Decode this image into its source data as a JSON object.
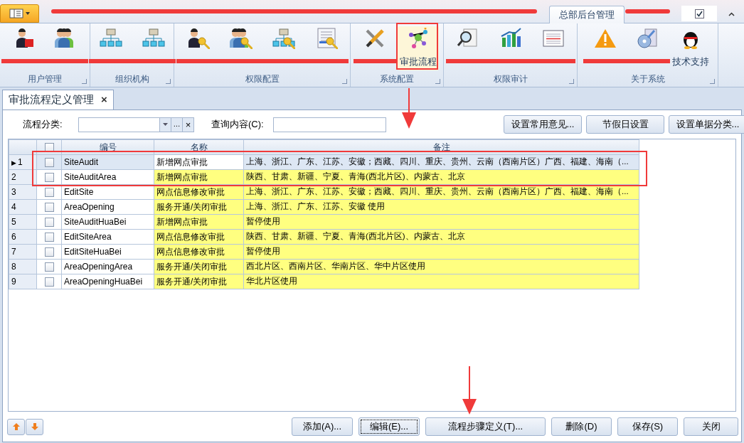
{
  "ribbon_tabs": [
    {
      "kind": "struck"
    },
    {
      "label": "总部后台管理",
      "selected": true
    },
    {
      "kind": "struck"
    }
  ],
  "ribbon_groups": [
    {
      "title": "用户管理",
      "buttons": [
        {
          "kind": "struck"
        },
        {
          "kind": "struck"
        }
      ]
    },
    {
      "title": "组织机构",
      "buttons": [
        {
          "kind": "struck"
        },
        {
          "kind": "struck"
        }
      ]
    },
    {
      "title": "权限配置",
      "buttons": [
        {
          "kind": "struck"
        },
        {
          "kind": "struck"
        },
        {
          "kind": "struck"
        },
        {
          "kind": "struck"
        }
      ]
    },
    {
      "title": "系统配置",
      "buttons": [
        {
          "kind": "struck"
        },
        {
          "label": "审批流程",
          "selected": true
        }
      ]
    },
    {
      "title": "权限审计",
      "buttons": [
        {
          "kind": "struck"
        },
        {
          "kind": "struck"
        },
        {
          "kind": "struck"
        }
      ]
    },
    {
      "title": "关于系统",
      "buttons": [
        {
          "kind": "struck"
        },
        {
          "kind": "struck"
        },
        {
          "label": "技术支持",
          "selected": false
        }
      ]
    }
  ],
  "document_tab": {
    "title": "审批流程定义管理",
    "close": "×"
  },
  "filter": {
    "category_label": "流程分类:",
    "query_label": "查询内容(C):",
    "combo_buttons": [
      "…",
      "×"
    ]
  },
  "top_buttons": [
    "设置常用意见...",
    "节假日设置",
    "设置单据分类..."
  ],
  "quick_checkbox": {
    "checked": true
  },
  "grid": {
    "current_marker": "▶",
    "all_checked": false,
    "columns": [
      "编号",
      "名称",
      "备注"
    ],
    "rows": [
      {
        "number": "1",
        "code": "SiteAudit",
        "name": "新增网点审批",
        "remark": "上海、浙江、广东、江苏、安徽；西藏、四川、重庆、贵州、云南（西南片区）广西、福建、海南（...",
        "selected": true,
        "checked": false
      },
      {
        "number": "2",
        "code": "SiteAuditArea",
        "name": "新增网点审批",
        "remark": "陕西、甘肃、新疆、宁夏、青海(西北片区)、内蒙古、北京",
        "selected": false,
        "checked": false
      },
      {
        "number": "3",
        "code": "EditSite",
        "name": "网点信息修改审批",
        "remark": "上海、浙江、广东、江苏、安徽；西藏、四川、重庆、贵州、云南（西南片区）广西、福建、海南（...",
        "selected": false,
        "checked": false
      },
      {
        "number": "4",
        "code": "AreaOpening",
        "name": "服务开通/关闭审批",
        "remark": "上海、浙江、广东、江苏、安徽 使用",
        "selected": false,
        "checked": false
      },
      {
        "number": "5",
        "code": "SiteAuditHuaBei",
        "name": "新增网点审批",
        "remark": "暂停使用",
        "selected": false,
        "checked": false
      },
      {
        "number": "6",
        "code": "EditSiteArea",
        "name": "网点信息修改审批",
        "remark": "陕西、甘肃、新疆、宁夏、青海(西北片区)、内蒙古、北京",
        "selected": false,
        "checked": false
      },
      {
        "number": "7",
        "code": "EditSiteHuaBei",
        "name": "网点信息修改审批",
        "remark": "暂停使用",
        "selected": false,
        "checked": false
      },
      {
        "number": "8",
        "code": "AreaOpeningArea",
        "name": "服务开通/关闭审批",
        "remark": "西北片区、西南片区、华南片区、华中片区使用",
        "selected": false,
        "checked": false
      },
      {
        "number": "9",
        "code": "AreaOpeningHuaBei",
        "name": "服务开通/关闭审批",
        "remark": "华北片区使用",
        "selected": false,
        "checked": false
      }
    ]
  },
  "bottom_buttons": [
    {
      "label": "添加(A)...",
      "focused": false
    },
    {
      "label": "编辑(E)...",
      "focused": true
    },
    {
      "label": "流程步骤定义(T)...",
      "focused": false
    },
    {
      "label": "删除(D)",
      "focused": false
    },
    {
      "label": "保存(S)",
      "focused": false
    },
    {
      "label": "关闭",
      "focused": false
    }
  ]
}
